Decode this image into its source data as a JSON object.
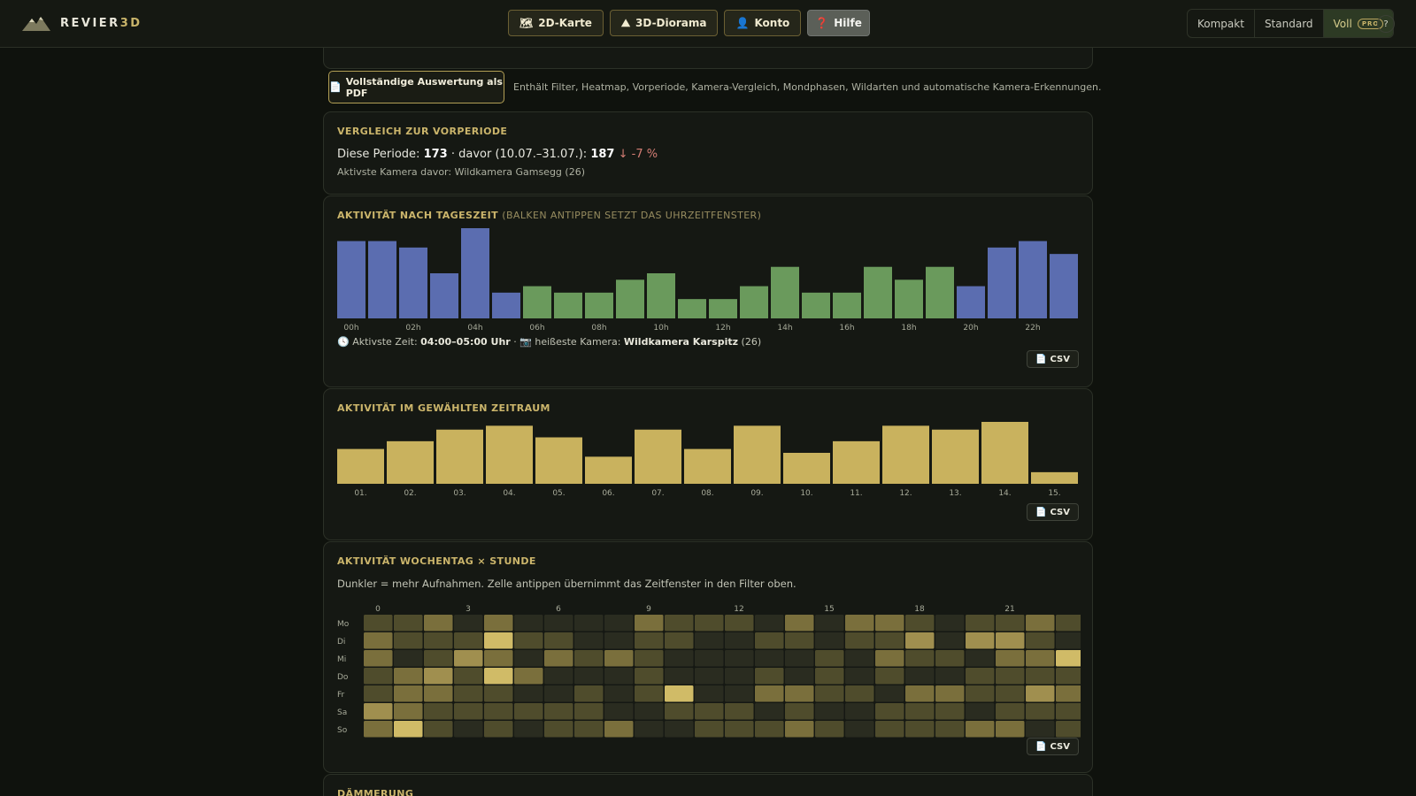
{
  "brand": {
    "name_a": "REVIER",
    "name_b": "3D"
  },
  "nav": {
    "map2d": "2D-Karte",
    "diorama": "3D-Diorama",
    "account": "Konto",
    "help": "Hilfe"
  },
  "view_modes": {
    "compact": "Kompakt",
    "standard": "Standard",
    "full": "Voll",
    "pro_badge": "PRO",
    "active": "full"
  },
  "help_circle": "?",
  "pdf": {
    "button": "Vollständige Auswertung als PDF",
    "note": "Enthält Filter, Heatmap, Vorperiode, Kamera-Vergleich, Mondphasen, Wildarten und automatische Kamera-Erkennungen."
  },
  "comparison": {
    "title": "Vergleich zur Vorperiode",
    "this_label": "Diese Periode:",
    "this_value": "173",
    "prev_label": "· davor (10.07.–31.07.):",
    "prev_value": "187",
    "change": "↓ -7 %",
    "sub": "Aktivste Kamera davor: Wildkamera Gamsegg (26)"
  },
  "hourly": {
    "title": "Aktivität nach Tageszeit",
    "hint": "(Balken antippen setzt das Uhrzeitfenster)",
    "info_prefix": "🕓 Aktivste Zeit:",
    "info_time": "04:00–05:00 Uhr",
    "info_mid": "· 📷 heißeste Kamera:",
    "info_camera": "Wildkamera Karspitz",
    "info_count": "(26)",
    "csv": "CSV"
  },
  "period": {
    "title": "Aktivität im gewählten Zeitraum",
    "csv": "CSV"
  },
  "heatmap": {
    "title": "Aktivität Wochentag × Stunde",
    "desc": "Dunkler = mehr Aufnahmen. Zelle antippen übernimmt das Zeitfenster in den Filter oben.",
    "csv": "CSV"
  },
  "twilight": {
    "title": "Dämmerung"
  },
  "colors": {
    "night": "#5b6db0",
    "day": "#6a9a5c",
    "gold": "#c9b25e",
    "heat_levels": [
      "#1e231b",
      "#2a2c20",
      "#4f4c2c",
      "#7a6f3c",
      "#a08f4f",
      "#d0bb67"
    ]
  },
  "chart_data": [
    {
      "type": "bar",
      "title": "Aktivität nach Tageszeit",
      "categories": [
        "00h",
        "01h",
        "02h",
        "03h",
        "04h",
        "05h",
        "06h",
        "07h",
        "08h",
        "09h",
        "10h",
        "11h",
        "12h",
        "13h",
        "14h",
        "15h",
        "16h",
        "17h",
        "18h",
        "19h",
        "20h",
        "21h",
        "22h",
        "23h"
      ],
      "tick_labels": [
        "00h",
        "02h",
        "04h",
        "06h",
        "08h",
        "10h",
        "12h",
        "14h",
        "16h",
        "18h",
        "20h",
        "22h"
      ],
      "values": [
        12,
        12,
        11,
        7,
        14,
        4,
        5,
        4,
        4,
        6,
        7,
        3,
        3,
        5,
        8,
        4,
        4,
        8,
        6,
        8,
        5,
        11,
        12,
        10
      ],
      "night_hours": [
        0,
        1,
        2,
        3,
        4,
        5,
        20,
        21,
        22,
        23
      ],
      "ylim": [
        0,
        14
      ],
      "grid": false
    },
    {
      "type": "bar",
      "title": "Aktivität im gewählten Zeitraum",
      "categories": [
        "01.",
        "02.",
        "03.",
        "04.",
        "05.",
        "06.",
        "07.",
        "08.",
        "09.",
        "10.",
        "11.",
        "12.",
        "13.",
        "14.",
        "15."
      ],
      "values": [
        9,
        11,
        14,
        15,
        12,
        7,
        14,
        9,
        15,
        8,
        11,
        15,
        14,
        16,
        3
      ],
      "ylim": [
        0,
        16
      ],
      "grid": false
    },
    {
      "type": "heatmap",
      "title": "Aktivität Wochentag × Stunde",
      "rows": [
        "Mo",
        "Di",
        "Mi",
        "Do",
        "Fr",
        "Sa",
        "So"
      ],
      "columns": [
        0,
        1,
        2,
        3,
        4,
        5,
        6,
        7,
        8,
        9,
        10,
        11,
        12,
        13,
        14,
        15,
        16,
        17,
        18,
        19,
        20,
        21,
        22,
        23
      ],
      "tick_labels": [
        "0",
        "3",
        "6",
        "9",
        "12",
        "15",
        "18",
        "21"
      ],
      "values": [
        [
          2,
          2,
          3,
          1,
          3,
          1,
          1,
          1,
          1,
          3,
          2,
          2,
          2,
          1,
          3,
          1,
          3,
          3,
          2,
          1,
          2,
          2,
          3,
          2
        ],
        [
          3,
          2,
          2,
          2,
          5,
          2,
          2,
          1,
          1,
          2,
          2,
          1,
          1,
          2,
          2,
          1,
          2,
          2,
          4,
          1,
          4,
          4,
          2,
          1
        ],
        [
          3,
          1,
          2,
          4,
          3,
          1,
          3,
          2,
          3,
          2,
          1,
          1,
          1,
          1,
          1,
          2,
          1,
          3,
          2,
          2,
          1,
          3,
          3,
          5
        ],
        [
          2,
          3,
          4,
          2,
          5,
          3,
          1,
          1,
          1,
          2,
          1,
          1,
          1,
          2,
          1,
          2,
          1,
          2,
          1,
          1,
          2,
          2,
          2,
          2
        ],
        [
          2,
          3,
          3,
          2,
          2,
          1,
          1,
          2,
          1,
          2,
          5,
          1,
          1,
          3,
          3,
          2,
          2,
          1,
          3,
          3,
          2,
          2,
          4,
          3
        ],
        [
          4,
          3,
          2,
          2,
          2,
          2,
          2,
          2,
          1,
          1,
          2,
          2,
          2,
          1,
          2,
          1,
          1,
          2,
          2,
          2,
          1,
          2,
          2,
          2
        ],
        [
          3,
          5,
          2,
          1,
          2,
          1,
          2,
          2,
          3,
          1,
          1,
          2,
          2,
          2,
          3,
          2,
          1,
          2,
          2,
          2,
          3,
          3,
          1,
          2
        ]
      ]
    }
  ]
}
